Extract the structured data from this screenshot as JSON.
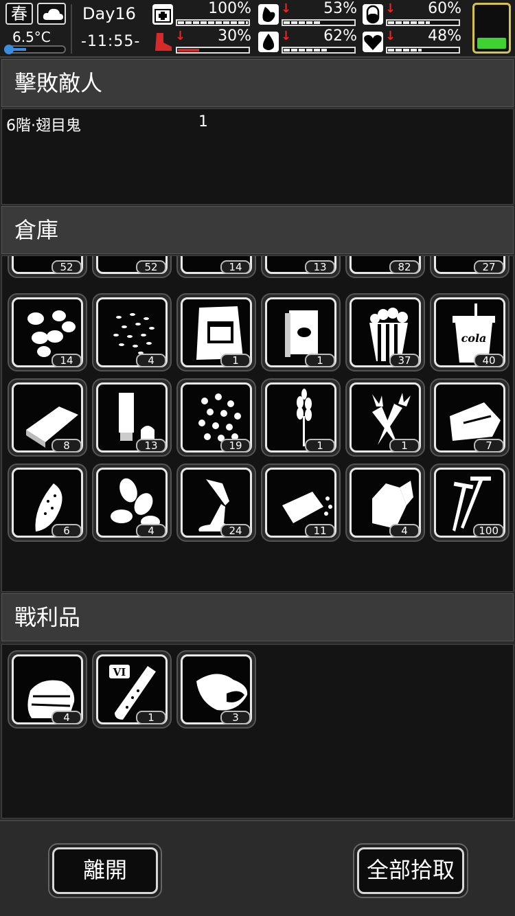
{
  "status": {
    "season": "春",
    "weather_icon": "cloud-icon",
    "temperature": "6.5°C",
    "day": "Day16",
    "time": "-11:55-",
    "stats": [
      {
        "id": "health",
        "icon": "first-aid-icon",
        "value": "100%",
        "level": 1.0,
        "down": false
      },
      {
        "id": "stomach",
        "icon": "stomach-icon",
        "value": "53%",
        "level": 0.53,
        "down": true
      },
      {
        "id": "pill",
        "icon": "pill-icon",
        "value": "60%",
        "level": 0.6,
        "down": true
      },
      {
        "id": "stamina",
        "icon": "boot-icon",
        "value": "30%",
        "level": 0.3,
        "down": true,
        "color": "#d62a2a"
      },
      {
        "id": "water",
        "icon": "water-drop-icon",
        "value": "62%",
        "level": 0.62,
        "down": true
      },
      {
        "id": "mood",
        "icon": "heart-icon",
        "value": "48%",
        "level": 0.48,
        "down": true
      }
    ],
    "battery_level": 0.25,
    "battery_color": "#3fd230"
  },
  "defeated": {
    "title": "擊敗敵人",
    "enemies": [
      {
        "name": "6階·翅目鬼",
        "count": "1"
      }
    ]
  },
  "storage": {
    "title": "倉庫",
    "rows": [
      [
        {
          "icon": "item-icon",
          "qty": "52"
        },
        {
          "icon": "item-icon",
          "qty": "52"
        },
        {
          "icon": "item-icon",
          "qty": "14"
        },
        {
          "icon": "item-icon",
          "qty": "13"
        },
        {
          "icon": "item-icon",
          "qty": "82"
        },
        {
          "icon": "item-icon",
          "qty": "27"
        }
      ],
      [
        {
          "icon": "nuts-icon",
          "qty": "14"
        },
        {
          "icon": "seeds-icon",
          "qty": "4"
        },
        {
          "icon": "snack-bag-icon",
          "qty": "1"
        },
        {
          "icon": "book-icon",
          "qty": "1"
        },
        {
          "icon": "popcorn-icon",
          "qty": "37"
        },
        {
          "icon": "cola-cup-icon",
          "qty": "40",
          "label": "cola"
        }
      ],
      [
        {
          "icon": "chocolate-bar-icon",
          "qty": "8"
        },
        {
          "icon": "tube-icon",
          "qty": "13"
        },
        {
          "icon": "beans-icon",
          "qty": "19"
        },
        {
          "icon": "wheat-icon",
          "qty": "1"
        },
        {
          "icon": "carrot-icon",
          "qty": "1"
        },
        {
          "icon": "cloth-icon",
          "qty": "7"
        }
      ],
      [
        {
          "icon": "corn-icon",
          "qty": "6"
        },
        {
          "icon": "almond-icon",
          "qty": "4"
        },
        {
          "icon": "flour-icon",
          "qty": "24"
        },
        {
          "icon": "bread-icon",
          "qty": "11"
        },
        {
          "icon": "ore-icon",
          "qty": "4"
        },
        {
          "icon": "screws-icon",
          "qty": "100"
        }
      ]
    ]
  },
  "loot": {
    "title": "戰利品",
    "items": [
      {
        "icon": "cloth-stack-icon",
        "qty": "4"
      },
      {
        "icon": "test-tube-icon",
        "qty": "1",
        "label": "VI"
      },
      {
        "icon": "meat-icon",
        "qty": "3"
      }
    ]
  },
  "buttons": {
    "leave": "離開",
    "take_all": "全部拾取"
  }
}
